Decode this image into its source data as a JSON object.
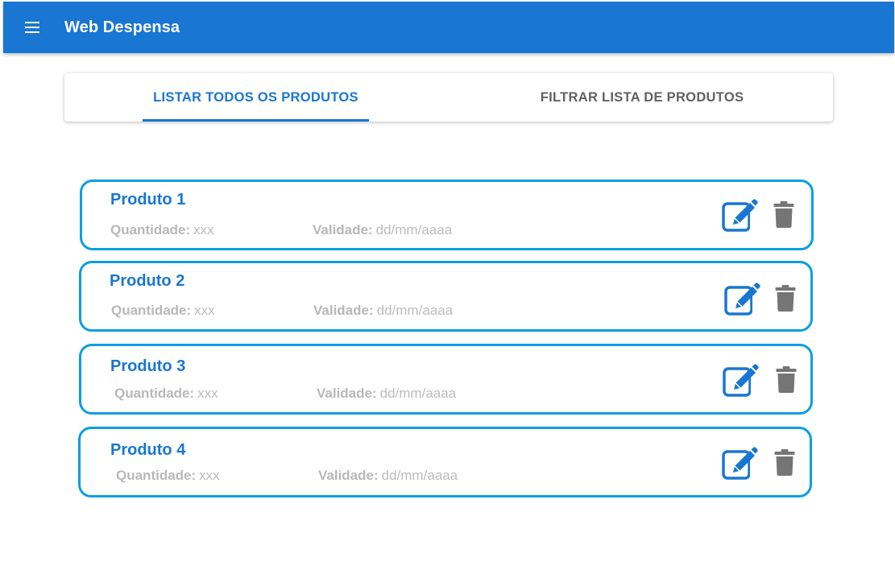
{
  "appbar": {
    "title": "Web Despensa",
    "menu_icon": "menu-icon",
    "color": "#1976d2"
  },
  "tabs": [
    {
      "label": "LISTAR TODOS OS PRODUTOS",
      "selected": true
    },
    {
      "label": "FILTRAR LISTA DE PRODUTOS",
      "selected": false
    }
  ],
  "products": [
    {
      "name": "Produto 1",
      "quantity_label": "Quantidade:",
      "quantity_value": "xxx",
      "validity_label": "Validade:",
      "validity_value": "dd/mm/aaaa"
    },
    {
      "name": "Produto 2",
      "quantity_label": "Quantidade:",
      "quantity_value": "xxx",
      "validity_label": "Validade:",
      "validity_value": "dd/mm/aaaa"
    },
    {
      "name": "Produto 3",
      "quantity_label": "Quantidade:",
      "quantity_value": "xxx",
      "validity_label": "Validade:",
      "validity_value": "dd/mm/aaaa"
    },
    {
      "name": "Produto 4",
      "quantity_label": "Quantidade:",
      "quantity_value": "xxx",
      "validity_label": "Validade:",
      "validity_value": "dd/mm/aaaa"
    }
  ],
  "icons": {
    "edit": "edit-icon",
    "delete": "trash-icon"
  },
  "colors": {
    "primary": "#1976d2",
    "card_border": "#0a9fe0",
    "muted_text": "#bdbdbd",
    "trash": "#757575"
  }
}
